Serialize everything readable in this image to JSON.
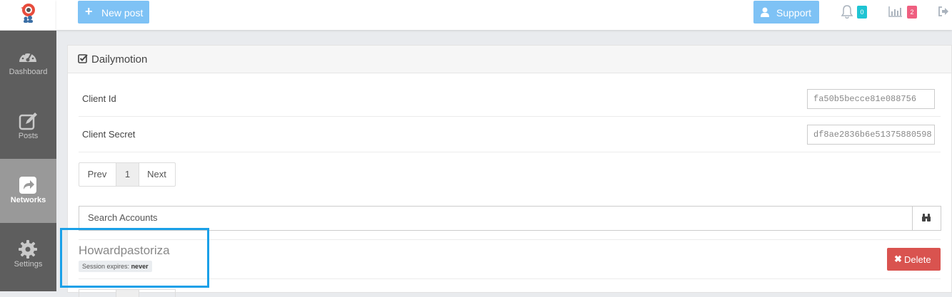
{
  "sidebar": {
    "logo": "logo-icon",
    "items": [
      {
        "label": "Dashboard",
        "icon": "dashboard-icon",
        "active": false
      },
      {
        "label": "Posts",
        "icon": "edit-icon",
        "active": false
      },
      {
        "label": "Networks",
        "icon": "share-icon",
        "active": true
      },
      {
        "label": "Settings",
        "icon": "gear-icon",
        "active": false
      }
    ]
  },
  "topbar": {
    "new_post_label": "New post",
    "support_label": "Support",
    "notifications_count": "0",
    "stats_count": "2"
  },
  "panel": {
    "title": "Dailymotion",
    "fields": [
      {
        "label": "Client Id",
        "value": "fa50b5becce81e088756"
      },
      {
        "label": "Client Secret",
        "value": "df8ae2836b6e51375880598"
      }
    ],
    "pagination": {
      "prev": "Prev",
      "page": "1",
      "next": "Next"
    },
    "search": {
      "placeholder": "Search Accounts"
    },
    "account": {
      "name": "Howardpastoriza",
      "session_label": "Session expires:",
      "session_value": "never",
      "delete_label": "Delete"
    }
  },
  "colors": {
    "sidebar_bg": "#5e5e5e",
    "sidebar_active": "#999999",
    "primary_button": "#7ec2f5",
    "delete_button": "#d9534f",
    "badge_teal": "#1fc4d3",
    "badge_pink": "#ef5f80",
    "highlight": "#1aa0e8"
  }
}
